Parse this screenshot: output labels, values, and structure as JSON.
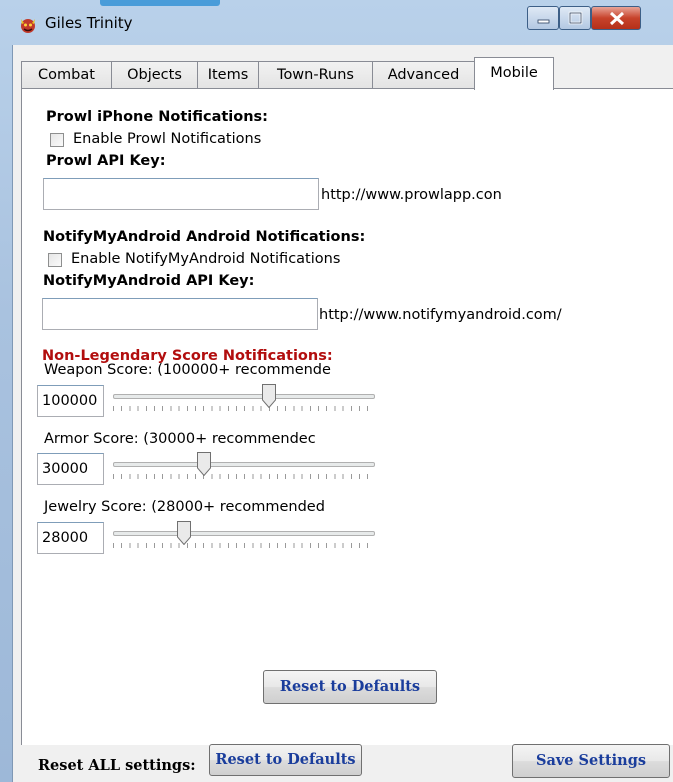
{
  "window": {
    "title": "Giles Trinity"
  },
  "tabs": [
    {
      "label": "Combat"
    },
    {
      "label": "Objects"
    },
    {
      "label": "Items"
    },
    {
      "label": "Town-Runs"
    },
    {
      "label": "Advanced"
    },
    {
      "label": "Mobile",
      "active": true
    }
  ],
  "prowl": {
    "heading": "Prowl iPhone Notifications:",
    "enable_label": "Enable Prowl Notifications",
    "enabled": false,
    "api_key_label": "Prowl API Key:",
    "api_key_value": "",
    "url": "http://www.prowlapp.con"
  },
  "nma": {
    "heading": "NotifyMyAndroid Android Notifications:",
    "enable_label": "Enable NotifyMyAndroid Notifications",
    "enabled": false,
    "api_key_label": "NotifyMyAndroid API Key:",
    "api_key_value": "",
    "url": "http://www.notifymyandroid.com/"
  },
  "scores": {
    "heading": "Non-Legendary Score Notifications:",
    "weapon": {
      "label": "Weapon Score: (100000+ recommende",
      "value": "100000",
      "fraction": 0.6
    },
    "armor": {
      "label": "Armor Score: (30000+ recommendec",
      "value": "30000",
      "fraction": 0.34
    },
    "jewelry": {
      "label": "Jewelry Score: (28000+ recommended",
      "value": "28000",
      "fraction": 0.26
    }
  },
  "buttons": {
    "reset_defaults": "Reset to Defaults",
    "reset_all_label": "Reset ALL settings:",
    "reset_all_button": "Reset to Defaults",
    "save": "Save Settings"
  },
  "colors": {
    "section_red": "#b20e0e",
    "button_text": "#1a3d9c"
  }
}
